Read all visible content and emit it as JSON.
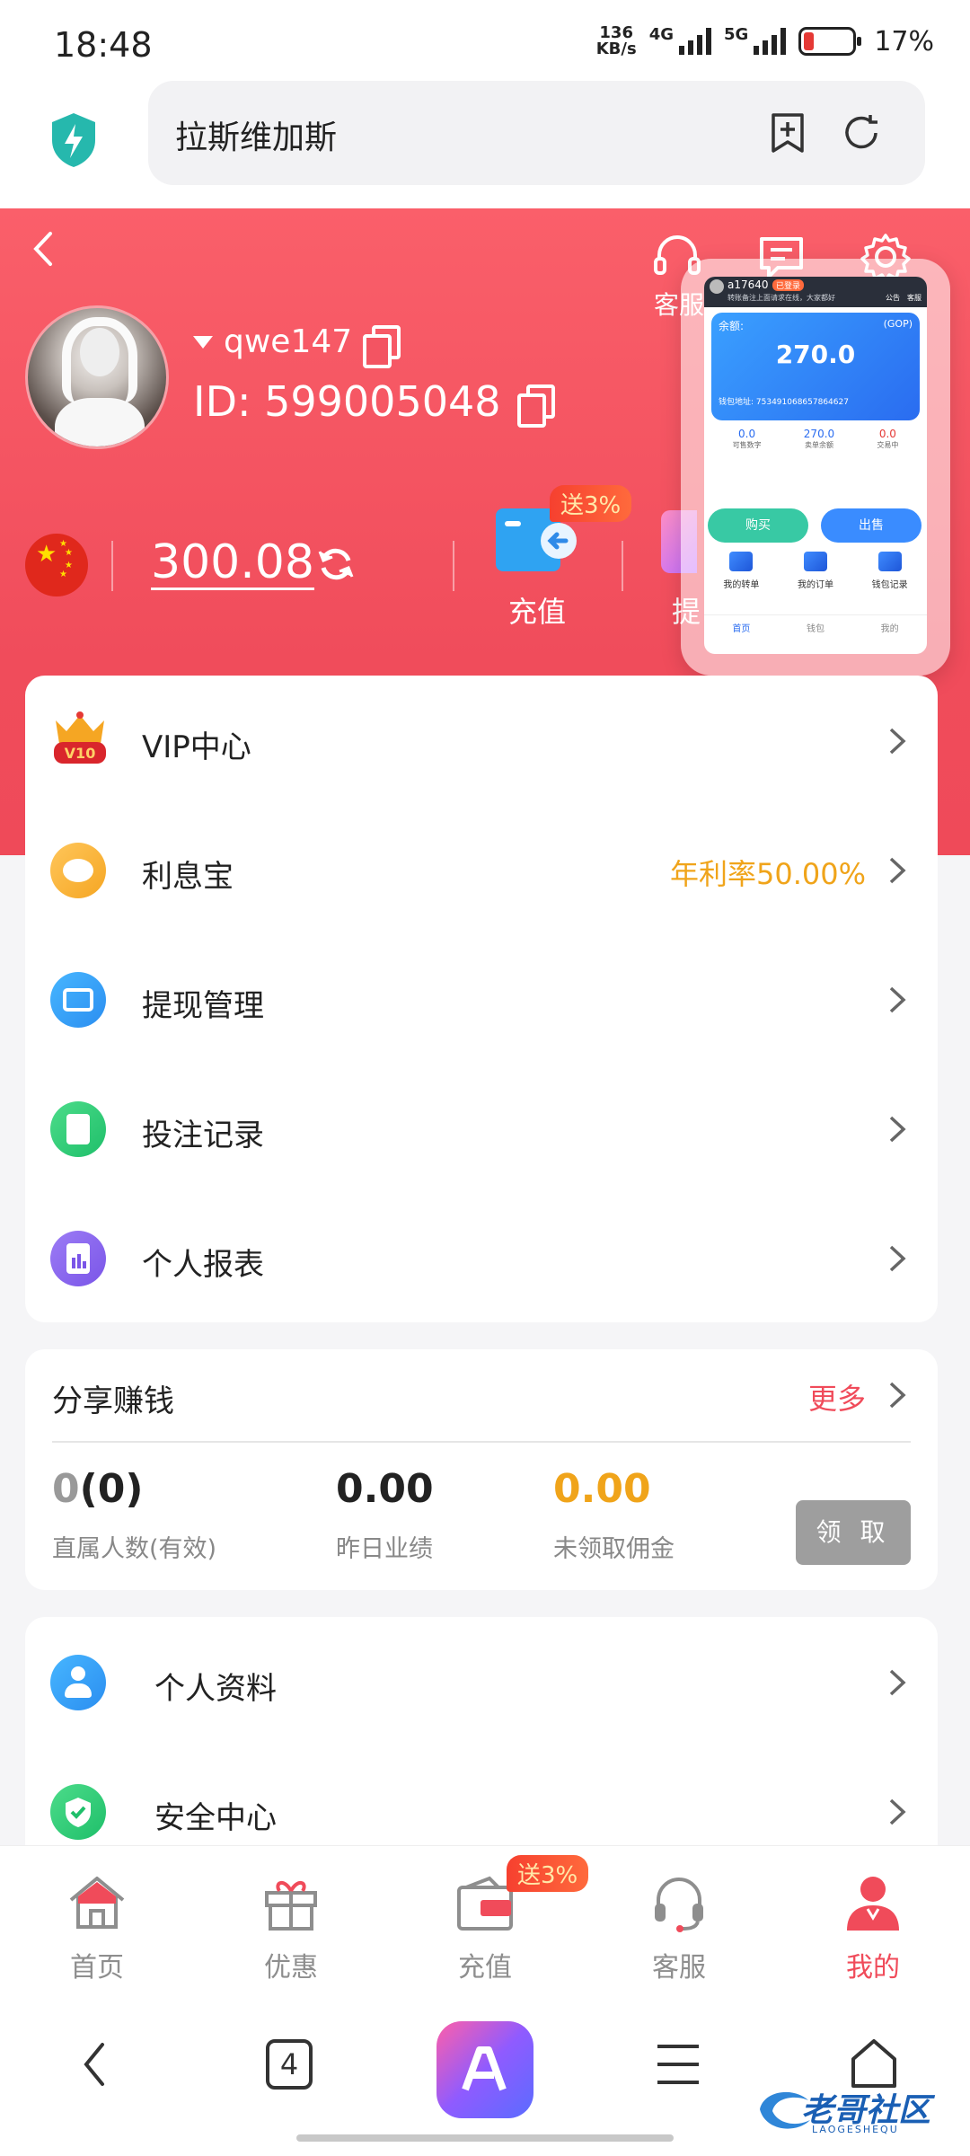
{
  "status_bar": {
    "time": "18:48",
    "net_speed_value": "136",
    "net_speed_unit": "KB/s",
    "sim1_tag": "4G",
    "sim2_tag": "5G",
    "battery": "17%"
  },
  "browser": {
    "url_title": "拉斯维加斯",
    "tab_count": "4"
  },
  "header": {
    "service_label": "客服",
    "username": "qwe147",
    "user_id": "ID: 599005048",
    "balance": "300.08",
    "recharge_label": "充值",
    "recharge_badge": "送3%",
    "withdraw_label_partial": "提"
  },
  "floating_preview": {
    "user": "a17640",
    "user_tag": "已登录",
    "notice": "转账备注上面请求在线，大家都好",
    "top_actions": [
      "公告",
      "客服"
    ],
    "balance_label": "余额:",
    "currency": "(GOP)",
    "balance_value": "270.0",
    "wallet_label": "钱包地址: 753491068657864627",
    "stats": [
      {
        "value": "0.0",
        "label": "可售数字"
      },
      {
        "value": "270.0",
        "label": "卖单余额"
      },
      {
        "value": "0.0",
        "label": "交易中"
      }
    ],
    "buy_label": "购买",
    "sell_label": "出售",
    "links": [
      "我的转单",
      "我的订单",
      "钱包记录"
    ],
    "nav": [
      "首页",
      "钱包",
      "我的"
    ]
  },
  "menu_top": [
    {
      "label": "VIP中心",
      "value": "",
      "vip_level": "V10"
    },
    {
      "label": "利息宝",
      "value": "年利率50.00%"
    },
    {
      "label": "提现管理",
      "value": ""
    },
    {
      "label": "投注记录",
      "value": ""
    },
    {
      "label": "个人报表",
      "value": ""
    }
  ],
  "share": {
    "title": "分享赚钱",
    "more": "更多",
    "direct_count_zero": "0",
    "direct_count_paren": "(0)",
    "direct_label": "直属人数(有效)",
    "yesterday_value": "0.00",
    "yesterday_label": "昨日业绩",
    "unclaimed_value": "0.00",
    "unclaimed_label": "未领取佣金",
    "claim_button": "领 取"
  },
  "menu_bottom": [
    {
      "label": "个人资料"
    },
    {
      "label": "安全中心"
    }
  ],
  "tabbar": {
    "items": [
      {
        "label": "首页"
      },
      {
        "label": "优惠"
      },
      {
        "label": "充值",
        "badge": "送3%"
      },
      {
        "label": "客服"
      },
      {
        "label": "我的"
      }
    ],
    "active_color": "#f04b5a",
    "inactive_color": "#8e8e8e"
  },
  "watermark": {
    "text": "老哥社区",
    "sub": "LAOGESHEQU"
  },
  "colors": {
    "header_red": "#f04c5b",
    "accent_orange": "#f0a41a"
  }
}
